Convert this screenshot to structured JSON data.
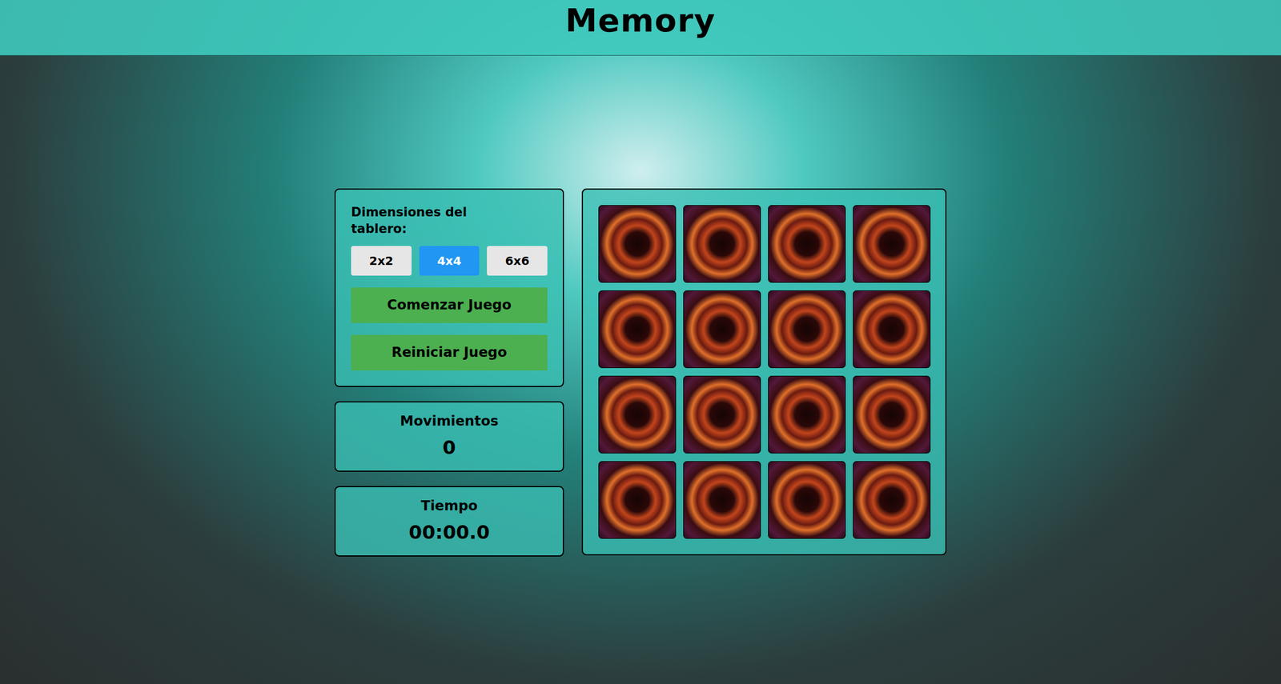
{
  "header": {
    "title": "Memory"
  },
  "settings": {
    "label": "Dimensiones del tablero:",
    "sizes": [
      {
        "label": "2x2",
        "selected": false
      },
      {
        "label": "4x4",
        "selected": true
      },
      {
        "label": "6x6",
        "selected": false
      }
    ],
    "buttons": [
      "Comenzar Juego",
      "Reiniciar Juego"
    ]
  },
  "moves": {
    "label": "Movimientos",
    "value": "0"
  },
  "time": {
    "label": "Tiempo",
    "value": "00:00.0"
  },
  "board": {
    "cards": [
      {
        "revealed": false
      },
      {
        "revealed": false
      },
      {
        "revealed": false
      },
      {
        "revealed": false
      },
      {
        "revealed": false
      },
      {
        "revealed": false
      },
      {
        "revealed": false
      },
      {
        "revealed": false
      },
      {
        "revealed": false
      },
      {
        "revealed": false
      },
      {
        "revealed": false
      },
      {
        "revealed": false
      },
      {
        "revealed": false
      },
      {
        "revealed": false
      },
      {
        "revealed": false
      },
      {
        "revealed": false
      }
    ]
  }
}
